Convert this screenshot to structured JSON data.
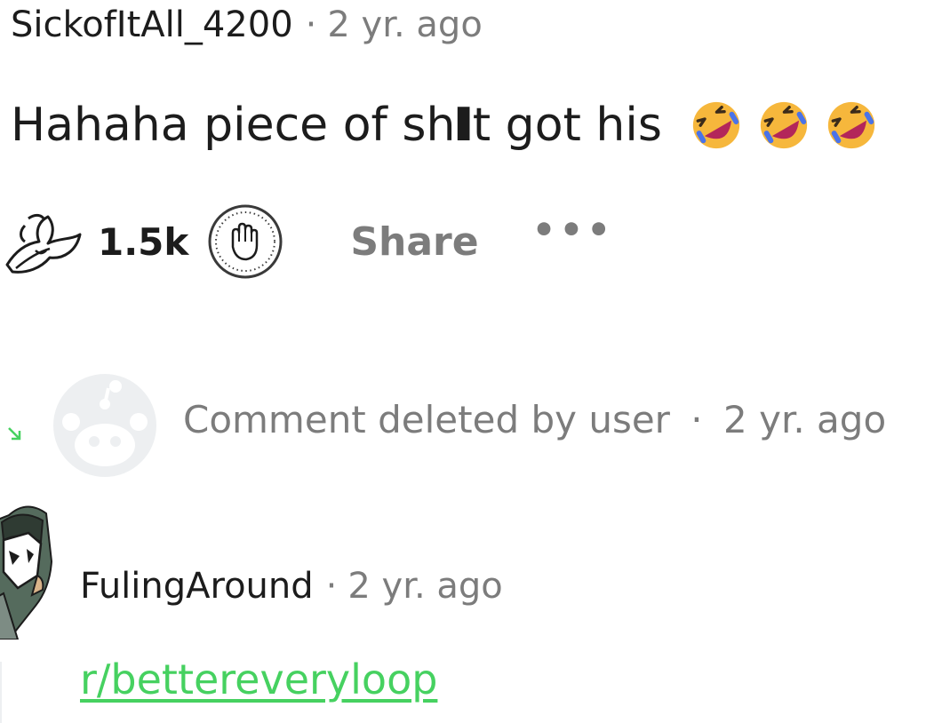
{
  "comment": {
    "author": "SickofItAll_4200",
    "separator": "·",
    "time": "2 yr. ago",
    "text_before": "Hahaha piece of sh",
    "text_cursor": "I",
    "text_after": "t got his",
    "emojis": [
      "rolling-on-floor-laughing-emoji",
      "rolling-on-floor-laughing-emoji",
      "rolling-on-floor-laughing-emoji"
    ]
  },
  "actions": {
    "upvote_icon": "upvote-leaf-icon",
    "vote_count": "1.5k",
    "award_icon": "award-hand-icon",
    "share_label": "Share",
    "more_label": "•••"
  },
  "deleted_comment": {
    "text": "Comment deleted by user",
    "separator": "·",
    "time": "2 yr. ago",
    "avatar_icon": "default-snoo-avatar-icon"
  },
  "reply": {
    "author": "FulingAround",
    "separator": "·",
    "time": "2 yr. ago",
    "link": "r/bettereveryloop"
  },
  "colors": {
    "text": "#1c1c1c",
    "muted": "#7c7c7c",
    "link": "#46d160",
    "avatar_bg": "#edeff1"
  }
}
